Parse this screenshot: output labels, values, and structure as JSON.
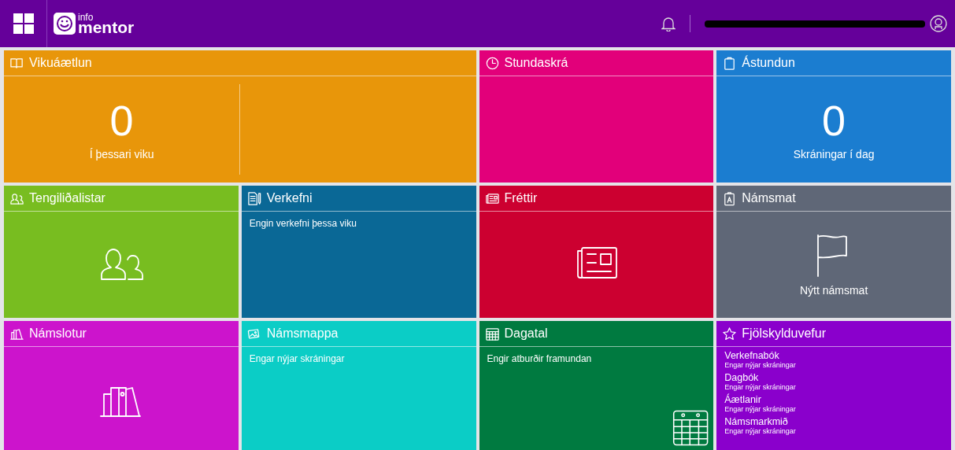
{
  "header": {
    "logo_small": "info",
    "logo_large": "mentor"
  },
  "tiles": [
    {
      "kind": "count",
      "title": "Vikuáætlun",
      "color": "#e8960a",
      "wide": true,
      "count": "0",
      "caption": "Í þessari viku"
    },
    {
      "kind": "blank",
      "title": "Stundaskrá",
      "color": "#e2007a",
      "wide": false
    },
    {
      "kind": "count",
      "title": "Ástundun",
      "color": "#1b7dd0",
      "wide": false,
      "count": "0",
      "caption": "Skráningar í dag"
    },
    {
      "kind": "icon",
      "title": "Tengiliðalistar",
      "color": "#78bd20",
      "wide": false
    },
    {
      "kind": "message",
      "title": "Verkefni",
      "color": "#0a6896",
      "wide": false,
      "message": "Engin verkefni þessa viku"
    },
    {
      "kind": "icon",
      "title": "Fréttir",
      "color": "#cc0030",
      "wide": false
    },
    {
      "kind": "icon",
      "title": "Námsmat",
      "color": "#5f6777",
      "wide": false,
      "caption": "Nýtt námsmat"
    },
    {
      "kind": "icon",
      "title": "Námslotur",
      "color": "#cc14cc",
      "wide": false
    },
    {
      "kind": "message",
      "title": "Námsmappa",
      "color": "#0bcdc6",
      "wide": false,
      "message": "Engar nýjar skráningar"
    },
    {
      "kind": "message",
      "title": "Dagatal",
      "color": "#007a40",
      "wide": false,
      "message": "Engir atburðir framundan"
    },
    {
      "kind": "links",
      "title": "Fjölskylduvefur",
      "color": "#8a00cc",
      "wide": false,
      "links": [
        {
          "label": "Verkefnabók",
          "note": "Engar nýjar skráningar"
        },
        {
          "label": "Dagbók",
          "note": "Engar nýjar skráningar"
        },
        {
          "label": "Áætlanir",
          "note": "Engar nýjar skráningar"
        },
        {
          "label": "Námsmarkmið",
          "note": "Engar nýjar skráningar"
        }
      ]
    }
  ]
}
